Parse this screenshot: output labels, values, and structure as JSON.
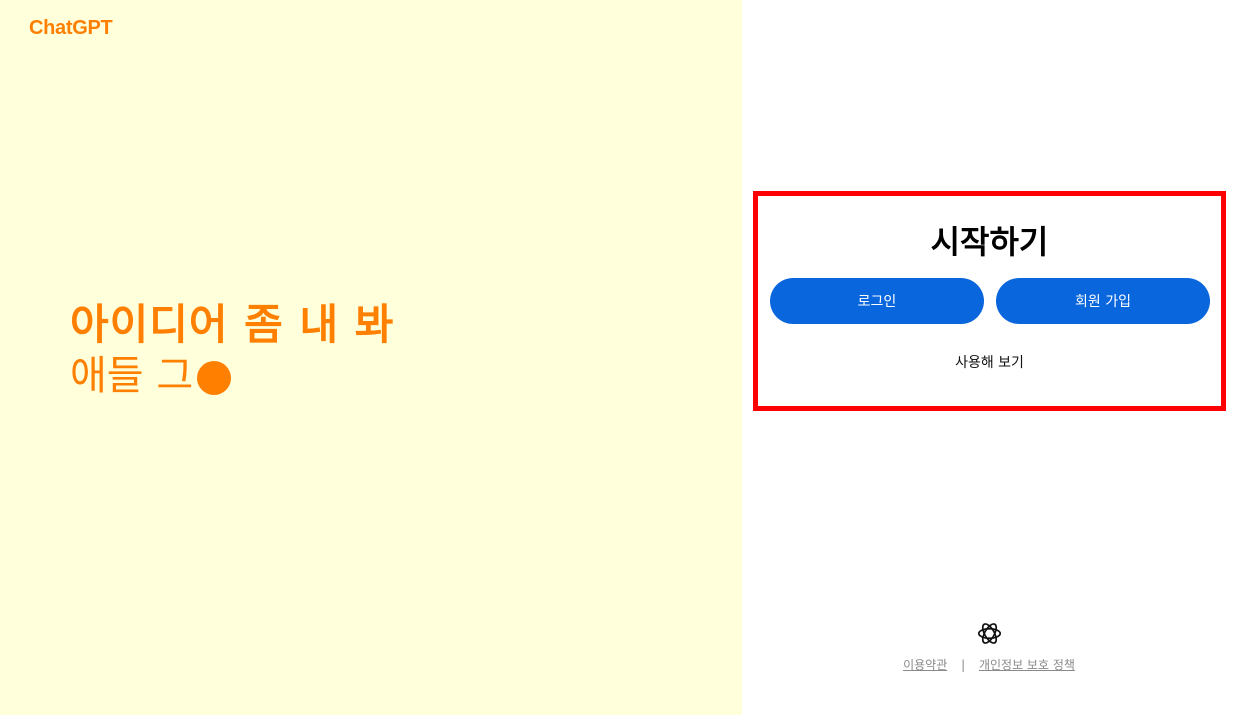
{
  "brand": "ChatGPT",
  "hero": {
    "line1": "아이디어 좀 내 봐",
    "line2": "애들 그"
  },
  "auth": {
    "title": "시작하기",
    "login_label": "로그인",
    "signup_label": "회원 가입",
    "try_label": "사용해 보기"
  },
  "footer": {
    "terms": "이용약관",
    "separator": "|",
    "privacy": "개인정보 보호 정책"
  },
  "colors": {
    "accent": "#ff7f00",
    "left_background": "#ffffdc",
    "button": "#0a66dc",
    "highlight_border": "#ff0000"
  },
  "icons": {
    "footer_logo": "openai-logo-icon",
    "hero_cursor": "orange-dot-icon"
  }
}
